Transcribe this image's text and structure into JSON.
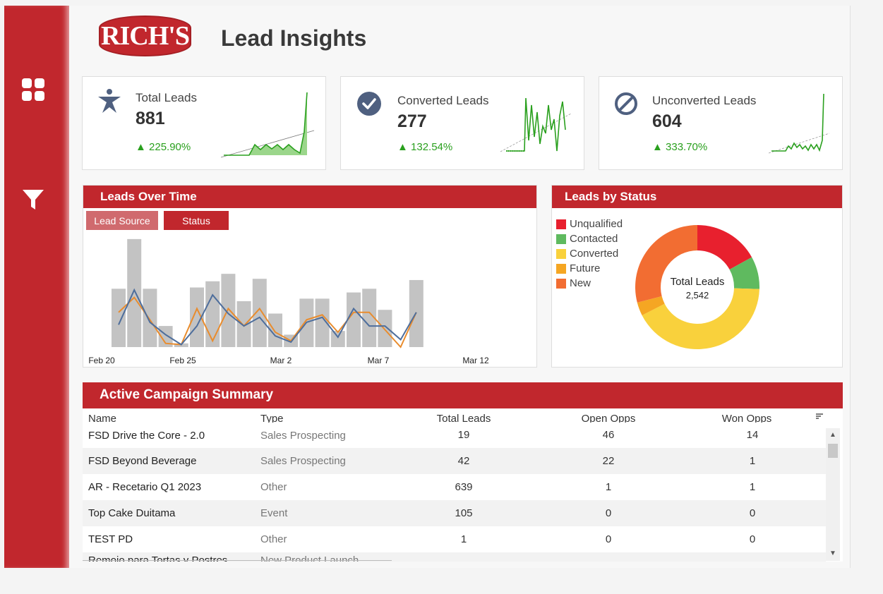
{
  "header": {
    "logo_text": "RICH'S",
    "title": "Lead Insights"
  },
  "colors": {
    "brand": "#c1272d",
    "positive": "#2aa01e",
    "kpi_icon": "#4f6080",
    "bar": "#c3c3c3",
    "series_a": "#4e6e9c",
    "series_b": "#e98c2d"
  },
  "kpis": [
    {
      "label": "Total Leads",
      "value": "881",
      "delta": "225.90%",
      "icon": "person-star-icon"
    },
    {
      "label": "Converted Leads",
      "value": "277",
      "delta": "132.54%",
      "icon": "check-circle-icon"
    },
    {
      "label": "Unconverted Leads",
      "value": "604",
      "delta": "333.70%",
      "icon": "ban-circle-icon"
    }
  ],
  "leads_over_time": {
    "title": "Leads Over Time",
    "tabs": [
      "Lead Source",
      "Status"
    ],
    "x_labels": [
      "Feb 20",
      "Feb 25",
      "Mar 2",
      "Mar 7",
      "Mar 12"
    ]
  },
  "leads_by_status": {
    "title": "Leads by Status",
    "center_label": "Total Leads",
    "center_value": "2,542",
    "legend": [
      {
        "name": "Unqualified",
        "color": "#e8202e"
      },
      {
        "name": "Contacted",
        "color": "#5fba5f"
      },
      {
        "name": "Converted",
        "color": "#f9d13c"
      },
      {
        "name": "Future",
        "color": "#f5a623"
      },
      {
        "name": "New",
        "color": "#f26d32"
      }
    ]
  },
  "campaigns": {
    "title": "Active Campaign Summary",
    "columns": [
      "Name",
      "Type",
      "Total Leads",
      "Open Opps",
      "Won Opps"
    ],
    "rows": [
      {
        "name": "FSD Drive the Core - 2.0",
        "type": "Sales Prospecting",
        "total": "19",
        "open": "46",
        "won": "14"
      },
      {
        "name": "FSD Beyond Beverage",
        "type": "Sales Prospecting",
        "total": "42",
        "open": "22",
        "won": "1"
      },
      {
        "name": "AR - Recetario Q1 2023",
        "type": "Other",
        "total": "639",
        "open": "1",
        "won": "1"
      },
      {
        "name": "Top Cake Duitama",
        "type": "Event",
        "total": "105",
        "open": "0",
        "won": "0"
      },
      {
        "name": "TEST PD",
        "type": "Other",
        "total": "1",
        "open": "0",
        "won": "0"
      },
      {
        "name": "Remojo para Tortas y Postres",
        "type": "New Product Launch",
        "total": "",
        "open": "",
        "won": ""
      }
    ]
  },
  "chart_data": [
    {
      "type": "bar",
      "title": "Leads Over Time",
      "x_tick_labels": [
        "Feb 20",
        "Feb 25",
        "Mar 2",
        "Mar 7",
        "Mar 12"
      ],
      "bars": [
        47,
        87,
        47,
        17,
        3,
        48,
        53,
        59,
        37,
        55,
        27,
        10,
        39,
        39,
        13,
        44,
        47,
        30,
        0,
        54
      ],
      "series": [
        {
          "values": [
            18,
            46,
            20,
            10,
            2,
            17,
            42,
            27,
            17,
            24,
            9,
            4,
            20,
            24,
            8,
            31,
            17,
            17,
            6,
            28
          ]
        },
        {
          "values": [
            28,
            40,
            22,
            3,
            2,
            31,
            5,
            31,
            17,
            31,
            12,
            5,
            22,
            26,
            12,
            28,
            28,
            14,
            0,
            28
          ]
        }
      ]
    },
    {
      "type": "pie",
      "title": "Leads by Status",
      "labels": [
        "Unqualified",
        "Contacted",
        "Converted",
        "Future",
        "New"
      ],
      "values": [
        17,
        8.5,
        42,
        3.5,
        29
      ]
    }
  ]
}
